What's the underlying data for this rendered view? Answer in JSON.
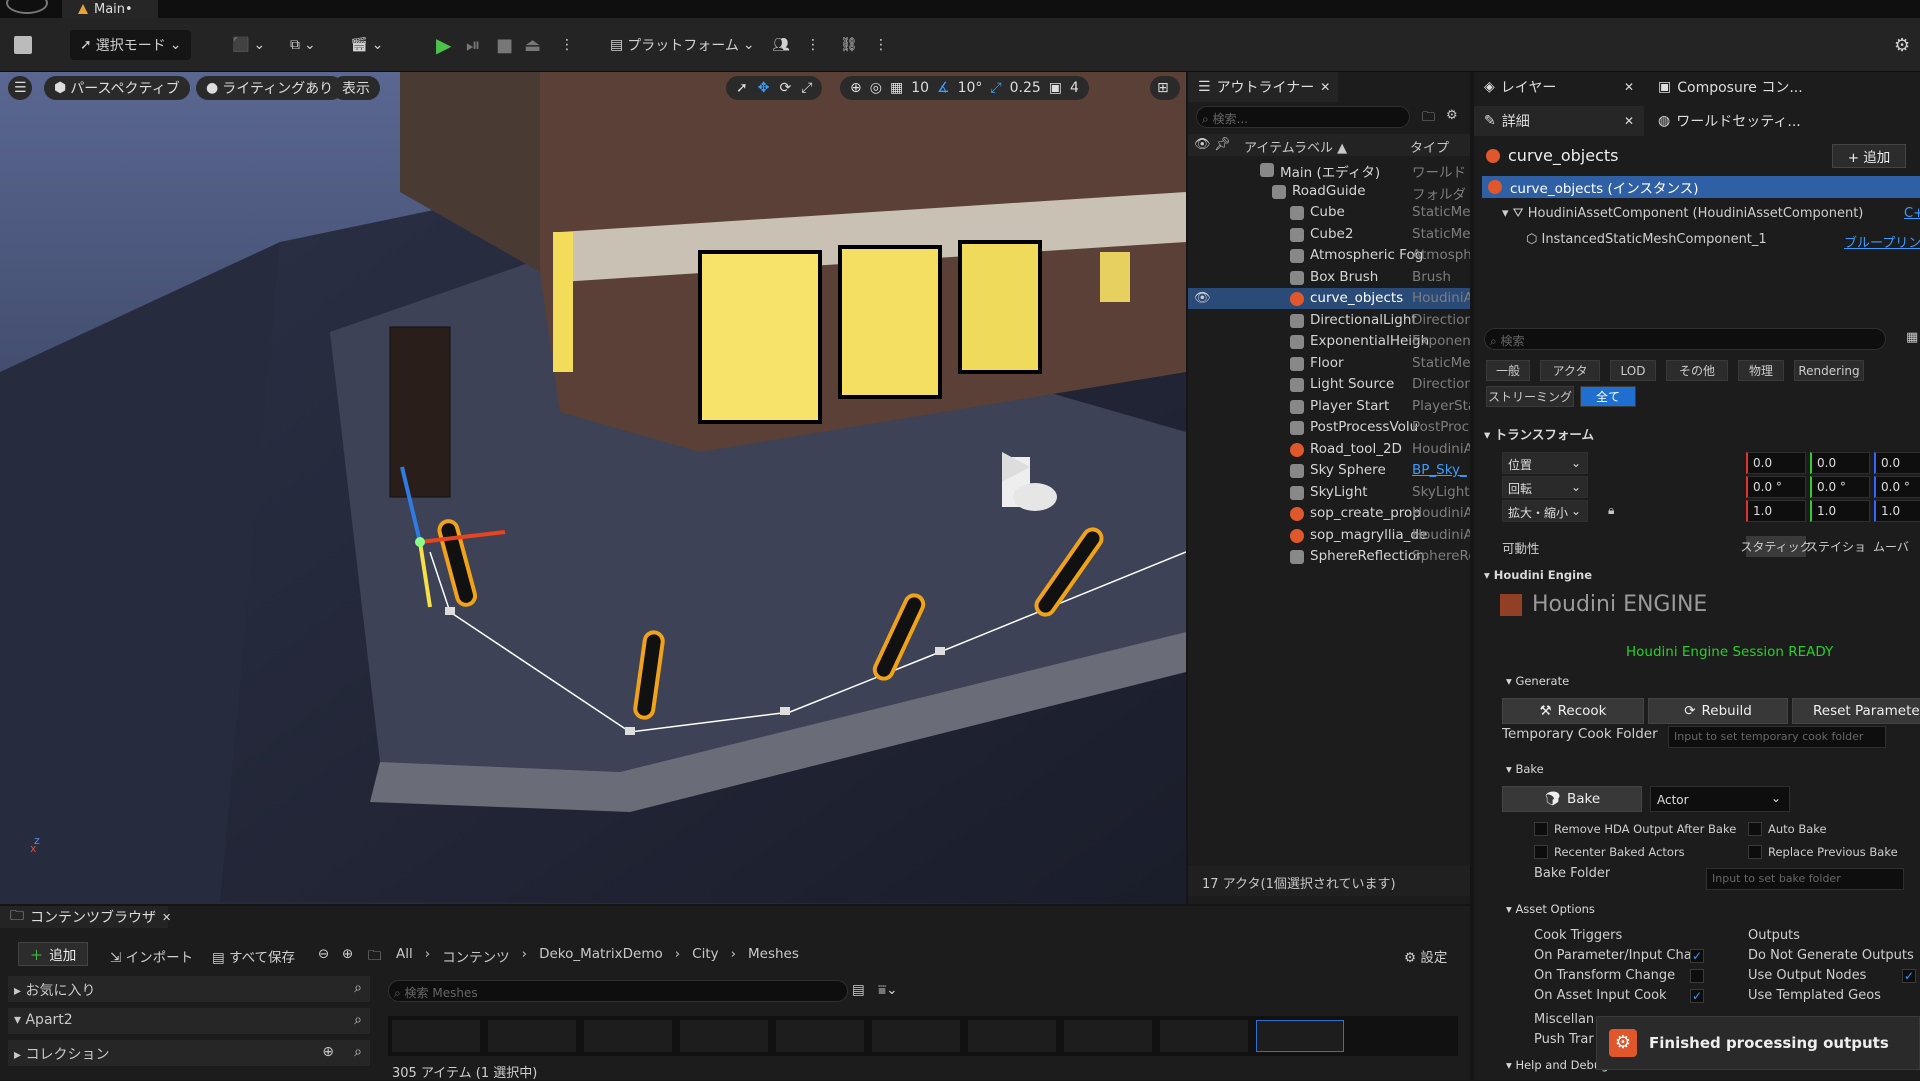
{
  "window": {
    "tab_title": "Main•"
  },
  "toolbar": {
    "select_mode": "選択モード",
    "platform": "プラットフォーム"
  },
  "viewport": {
    "perspective": "パースペクティブ",
    "lighting": "ライティングあり",
    "show": "表示",
    "grid_value": "10",
    "rotation_value": "10°",
    "scale_value": "0.25",
    "camera_value": "4",
    "gizmo_x": "x",
    "gizmo_z": "z"
  },
  "outliner": {
    "tab": "アウトライナー",
    "search_placeholder": "検索...",
    "col_label": "アイテムラベル ▲",
    "col_type": "タイプ",
    "footer": "17 アクタ(1個選択されています)",
    "items": [
      {
        "name": "Main (エディタ)",
        "type": "ワールド"
      },
      {
        "name": "RoadGuide",
        "type": "フォルダ"
      },
      {
        "name": "Cube",
        "type": "StaticMe"
      },
      {
        "name": "Cube2",
        "type": "StaticMe"
      },
      {
        "name": "Atmospheric Fog",
        "type": "Atmosphe"
      },
      {
        "name": "Box Brush",
        "type": "Brush"
      },
      {
        "name": "curve_objects",
        "type": "HoudiniA"
      },
      {
        "name": "DirectionalLight",
        "type": "Direction"
      },
      {
        "name": "ExponentialHeigh",
        "type": "Exponent"
      },
      {
        "name": "Floor",
        "type": "StaticMe"
      },
      {
        "name": "Light Source",
        "type": "Direction"
      },
      {
        "name": "Player Start",
        "type": "PlayerSta"
      },
      {
        "name": "PostProcessVolu",
        "type": "PostProc"
      },
      {
        "name": "Road_tool_2D",
        "type": "HoudiniA"
      },
      {
        "name": "Sky Sphere",
        "type": "BP_Sky_"
      },
      {
        "name": "SkyLight",
        "type": "SkyLight"
      },
      {
        "name": "sop_create_prop",
        "type": "HoudiniA"
      },
      {
        "name": "sop_magryllia_de",
        "type": "HoudiniA"
      },
      {
        "name": "SphereReflection",
        "type": "SphereRe"
      }
    ]
  },
  "details": {
    "tab_layers": "レイヤー",
    "tab_composure": "Composure コン...",
    "tab_details": "詳細",
    "tab_world": "ワールドセッティ...",
    "actor_name": "curve_objects",
    "add_button": "+ 追加",
    "instance": "curve_objects (インスタンス)",
    "component": "HoudiniAssetComponent (HoudiniAssetComponent)",
    "component_link": "C+",
    "subcomponent": "InstancedStaticMeshComponent_1",
    "blueprint_link": "ブループリン",
    "search_placeholder": "検索",
    "filters": [
      "一般",
      "アクタ",
      "LOD",
      "その他",
      "物理",
      "Rendering"
    ],
    "filters2": [
      "ストリーミング",
      "全て"
    ],
    "transform": {
      "header": "トランスフォーム",
      "location": "位置",
      "rotation": "回転",
      "scale": "拡大・縮小",
      "loc": [
        "0.0",
        "0.0",
        "0.0"
      ],
      "rot": [
        "0.0 °",
        "0.0 °",
        "0.0 °"
      ],
      "scl": [
        "1.0",
        "1.0",
        "1.0"
      ],
      "mobility": "可動性",
      "mob_static": "スタティック",
      "mob_stationary": "ステイショ",
      "mob_movable": "ムーバ"
    },
    "houdini": {
      "header": "Houdini Engine",
      "logo": "Houdini ENGINE",
      "session": "Houdini Engine Session READY",
      "generate": "Generate",
      "recook": "Recook",
      "rebuild": "Rebuild",
      "reset": "Reset Parameters",
      "temp_folder": "Temporary Cook Folder",
      "temp_placeholder": "Input to set temporary cook folder",
      "bake": "Bake",
      "bake_btn": "Bake",
      "bake_type": "Actor",
      "remove_hda": "Remove HDA Output After Bake",
      "auto_bake": "Auto Bake",
      "recenter": "Recenter Baked Actors",
      "replace_prev": "Replace Previous Bake",
      "bake_folder": "Bake Folder",
      "bake_placeholder": "Input to set bake folder",
      "asset_options": "Asset Options",
      "cook_triggers": "Cook Triggers",
      "outputs": "Outputs",
      "on_param": "On Parameter/Input Char",
      "on_transform": "On Transform Change",
      "on_asset_input": "On Asset Input Cook",
      "do_not_gen": "Do Not Generate Outputs",
      "use_output_nodes": "Use Output Nodes",
      "use_templated": "Use Templated Geos",
      "misc": "Miscellan",
      "push": "Push Trar",
      "help": "Help and Debug"
    }
  },
  "content_browser": {
    "tab": "コンテンツブラウザ",
    "add": "追加",
    "import": "インポート",
    "save_all": "すべて保存",
    "settings": "設定",
    "breadcrumb": [
      "All",
      "コンテンツ",
      "Deko_MatrixDemo",
      "City",
      "Meshes"
    ],
    "favorites": "お気に入り",
    "apart": "Apart2",
    "collections": "コレクション",
    "search_placeholder": "検索 Meshes",
    "status": "305 アイテム (1 選択中)"
  },
  "toast": {
    "message": "Finished processing outputs"
  }
}
